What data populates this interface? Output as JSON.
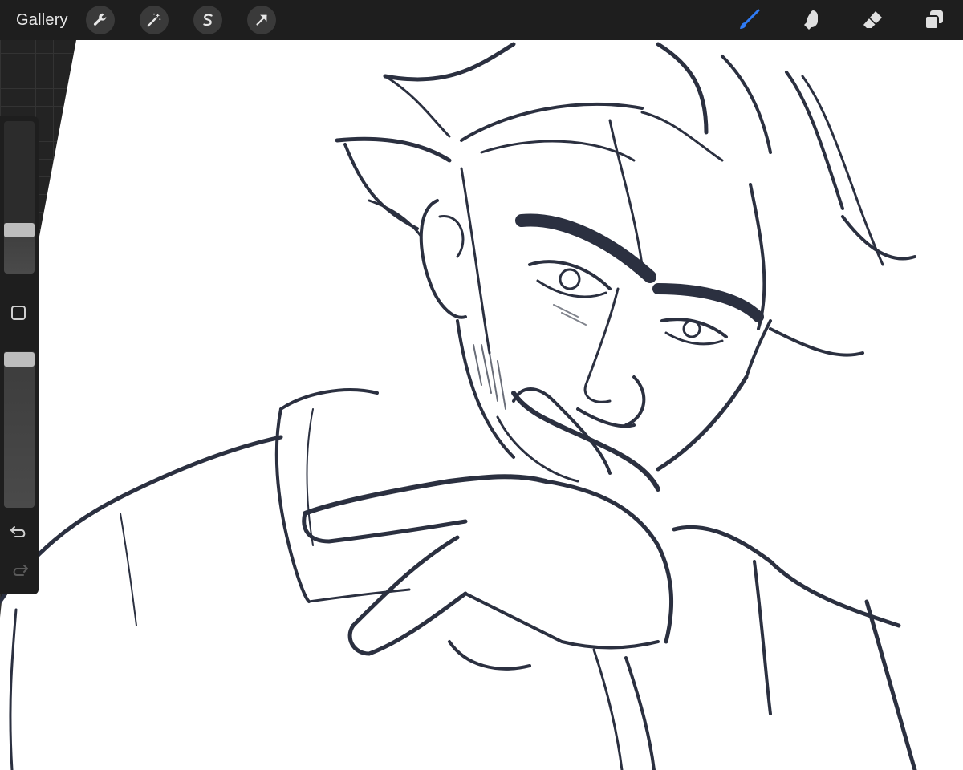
{
  "app": {
    "gallery_label": "Gallery"
  },
  "toolbar_left": [
    {
      "name": "actions",
      "icon": "wrench-icon"
    },
    {
      "name": "adjustments",
      "icon": "magic-wand-icon"
    },
    {
      "name": "selection",
      "icon": "selection-s-icon"
    },
    {
      "name": "transform",
      "icon": "arrow-cursor-icon"
    }
  ],
  "toolbar_right": [
    {
      "name": "brush",
      "icon": "brush-icon",
      "active": true,
      "color": "#2f7bf5"
    },
    {
      "name": "smudge",
      "icon": "smudge-finger-icon",
      "active": false,
      "color": "#e0e0e0"
    },
    {
      "name": "eraser",
      "icon": "eraser-icon",
      "active": false,
      "color": "#e0e0e0"
    },
    {
      "name": "layers",
      "icon": "layers-icon",
      "active": false,
      "color": "#e0e0e0"
    }
  ],
  "sidebar": {
    "brush_size_level": 0.26,
    "opacity_level": 0.99,
    "modify_button_icon": "square-icon",
    "undo_icon": "undo-arrow-icon",
    "redo_icon": "redo-arrow-icon"
  },
  "colors": {
    "ink": "#2b3040",
    "ui_bar": "#1e1e1e",
    "canvas": "#ffffff"
  }
}
